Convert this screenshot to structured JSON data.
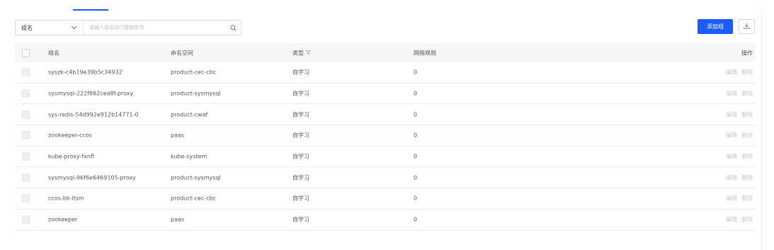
{
  "filter": {
    "group_select_label": "组名",
    "search_placeholder": "请输入组名进行模糊查询",
    "search_value": ""
  },
  "toolbar": {
    "add_label": "添加组"
  },
  "table": {
    "headers": {
      "name": "组名",
      "namespace": "命名空间",
      "type": "类型",
      "rules": "网络规则",
      "ops": "操作"
    },
    "rows": [
      {
        "name": "syszk-c4b19e39b5c34932",
        "namespace": "product-cec-cbc",
        "type": "自学习",
        "rules": "0",
        "edit": "编辑",
        "delete": "删除"
      },
      {
        "name": "sysmysql-222f882cea8f-proxy",
        "namespace": "product-sysmysql",
        "type": "自学习",
        "rules": "0",
        "edit": "编辑",
        "delete": "删除"
      },
      {
        "name": "sys-redis-54d992e912b14771-0",
        "namespace": "product-cwaf",
        "type": "自学习",
        "rules": "0",
        "edit": "编辑",
        "delete": "删除"
      },
      {
        "name": "zookeeper-ccos",
        "namespace": "paas",
        "type": "自学习",
        "rules": "0",
        "edit": "编辑",
        "delete": "删除"
      },
      {
        "name": "kube-proxy-fxnfl",
        "namespace": "kube-system",
        "type": "自学习",
        "rules": "0",
        "edit": "编辑",
        "delete": "删除"
      },
      {
        "name": "sysmysql-96f6e6469105-proxy",
        "namespace": "product-sysmysql",
        "type": "自学习",
        "rules": "0",
        "edit": "编辑",
        "delete": "删除"
      },
      {
        "name": "ccos-bk-itsm",
        "namespace": "product-cec-cbc",
        "type": "自学习",
        "rules": "0",
        "edit": "编辑",
        "delete": "删除"
      },
      {
        "name": "zookeeper",
        "namespace": "paas",
        "type": "自学习",
        "rules": "0",
        "edit": "编辑",
        "delete": "删除"
      }
    ]
  },
  "colors": {
    "primary": "#1a5cff",
    "header_bg": "#f5f6f7",
    "disabled_text": "#c8c8c8"
  },
  "icons": {
    "select_arrow": "chevron-down-icon",
    "search": "search-icon",
    "download": "download-icon",
    "type_filter": "filter-icon"
  }
}
